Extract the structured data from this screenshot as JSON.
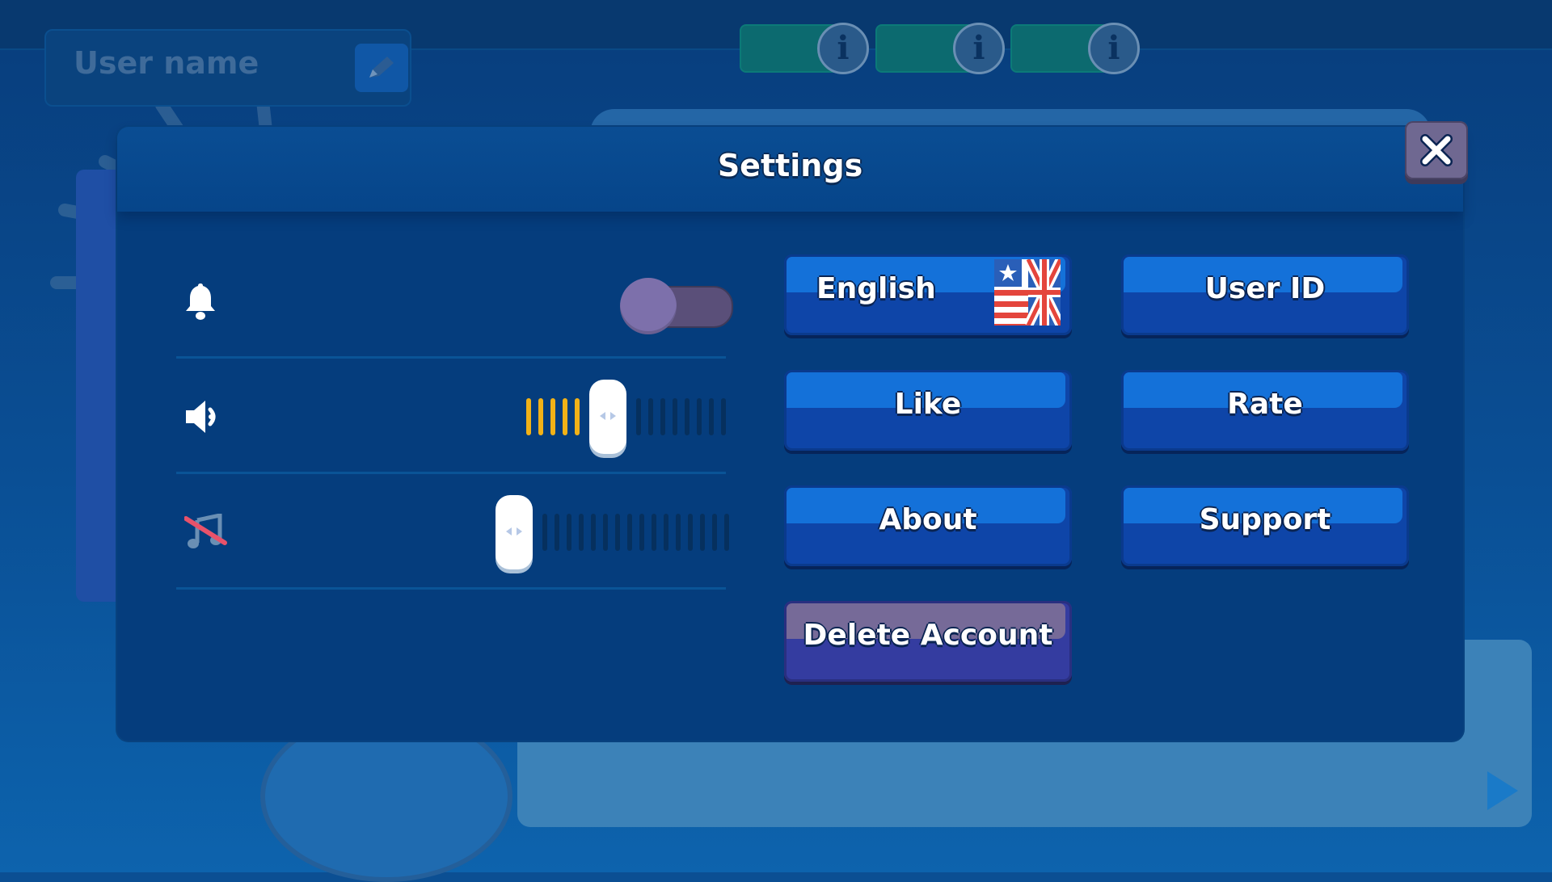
{
  "background": {
    "username_placeholder": "User name",
    "edit_icon": "pencil-icon",
    "info_icon_glyph": "i",
    "resource_count": 3
  },
  "settings": {
    "title": "Settings",
    "close_icon": "close-icon",
    "notifications": {
      "icon": "bell-icon",
      "enabled": false
    },
    "sound": {
      "icon": "speaker-icon",
      "level": 0.4
    },
    "music": {
      "icon": "music-muted-icon",
      "level": 0.0
    },
    "buttons": {
      "language": "English",
      "language_flag_icon": "us-uk-flag-icon",
      "user_id": "User ID",
      "like": "Like",
      "rate": "Rate",
      "about": "About",
      "support": "Support",
      "delete_account": "Delete Account"
    }
  },
  "colors": {
    "dialog_bg": "#053d7d",
    "button_blue": "#1471d9",
    "button_purple": "#766a98",
    "slider_active": "#f2b217",
    "toggle_off": "#5a4f79"
  }
}
